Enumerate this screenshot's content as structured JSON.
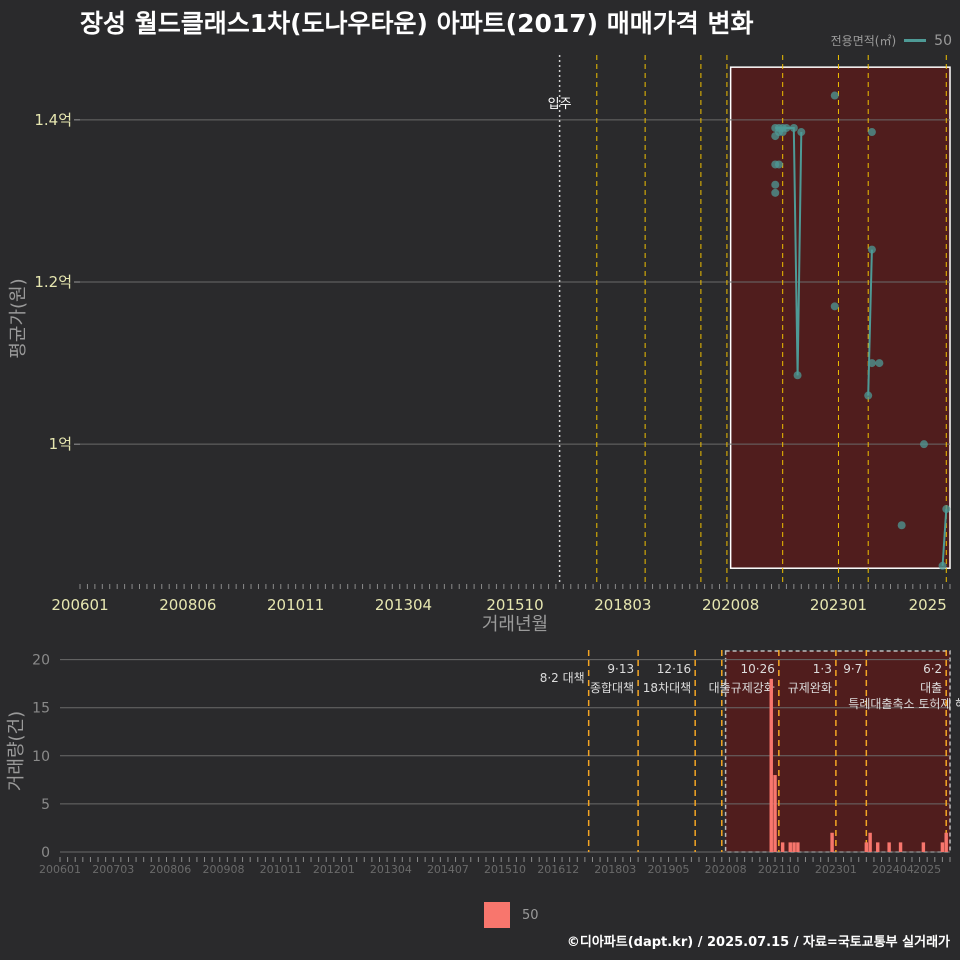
{
  "title": "장성 월드클래스1차(도나우타운) 아파트(2017) 매매가격 변화",
  "caption": "©디아파트(dapt.kr) / 2025.07.15 / 자료=국토교통부 실거래가",
  "legend_top": {
    "title": "전용면적(㎡)",
    "label": "50"
  },
  "legend_bottom": {
    "label": "50"
  },
  "colors": {
    "background": "#2a2a2c",
    "price_line": "#4e9a96",
    "volume_bar": "#f8766d",
    "policy_line": "#f0c000",
    "highlight_fill": "#5a1a1a"
  },
  "chart_data": [
    {
      "type": "line",
      "ylabel": "평균가(원)",
      "xlabel": "거래년월",
      "yticks": [
        {
          "v": 1.0,
          "label": "1억"
        },
        {
          "v": 1.2,
          "label": "1.2억"
        },
        {
          "v": 1.4,
          "label": "1.4억"
        }
      ],
      "ylim": [
        0.83,
        1.48
      ],
      "xticks": [
        "200601",
        "200806",
        "201011",
        "201304",
        "201510",
        "201803",
        "202008",
        "202301",
        "2025"
      ],
      "movein": {
        "x": "2016-10",
        "label": "입주"
      },
      "series": [
        {
          "name": "50",
          "points": [
            {
              "x": "2021-08",
              "y": 1.39
            },
            {
              "x": "2021-08",
              "y": 1.38
            },
            {
              "x": "2021-08",
              "y": 1.345
            },
            {
              "x": "2021-08",
              "y": 1.32
            },
            {
              "x": "2021-08",
              "y": 1.31
            },
            {
              "x": "2021-09",
              "y": 1.39
            },
            {
              "x": "2021-09",
              "y": 1.385
            },
            {
              "x": "2021-09",
              "y": 1.345
            },
            {
              "x": "2021-10",
              "y": 1.39
            },
            {
              "x": "2021-10",
              "y": 1.385
            },
            {
              "x": "2021-11",
              "y": 1.39
            },
            {
              "x": "2022-01",
              "y": 1.39
            },
            {
              "x": "2022-02",
              "y": 1.085
            },
            {
              "x": "2022-03",
              "y": 1.385
            },
            {
              "x": "2022-12",
              "y": 1.43
            },
            {
              "x": "2022-12",
              "y": 1.17
            },
            {
              "x": "2023-09",
              "y": 1.06
            },
            {
              "x": "2023-10",
              "y": 1.385
            },
            {
              "x": "2023-10",
              "y": 1.24
            },
            {
              "x": "2023-10",
              "y": 1.1
            },
            {
              "x": "2023-12",
              "y": 1.1
            },
            {
              "x": "2024-06",
              "y": 0.9
            },
            {
              "x": "2024-12",
              "y": 1.0
            },
            {
              "x": "2025-05",
              "y": 0.85
            },
            {
              "x": "2025-06",
              "y": 0.92
            }
          ],
          "line_path": [
            [
              "2021-08",
              1.39
            ],
            [
              "2021-09",
              1.39
            ],
            [
              "2021-10",
              1.39
            ],
            [
              "2021-11",
              1.39
            ],
            [
              "2022-01",
              1.39
            ],
            [
              "2022-02",
              1.085
            ],
            [
              "2022-03",
              1.385
            ]
          ],
          "line_path2": [
            [
              "2023-09",
              1.06
            ],
            [
              "2023-10",
              1.24
            ]
          ],
          "line_path3": [
            [
              "2025-05",
              0.85
            ],
            [
              "2025-06",
              0.92
            ]
          ]
        }
      ]
    },
    {
      "type": "bar",
      "ylabel": "거래량(건)",
      "yticks": [
        0,
        5,
        10,
        15,
        20
      ],
      "ylim": [
        0,
        21
      ],
      "xticks": [
        "200601",
        "200703",
        "200806",
        "200908",
        "201011",
        "201201",
        "201304",
        "201407",
        "201510",
        "201612",
        "201803",
        "201905",
        "202008",
        "202110",
        "202301",
        "202404",
        "2025"
      ],
      "series": [
        {
          "name": "50",
          "values": [
            {
              "x": "2021-08",
              "y": 18
            },
            {
              "x": "2021-09",
              "y": 8
            },
            {
              "x": "2021-11",
              "y": 1
            },
            {
              "x": "2022-01",
              "y": 1
            },
            {
              "x": "2022-02",
              "y": 1
            },
            {
              "x": "2022-03",
              "y": 1
            },
            {
              "x": "2022-12",
              "y": 2
            },
            {
              "x": "2023-09",
              "y": 1
            },
            {
              "x": "2023-10",
              "y": 2
            },
            {
              "x": "2023-12",
              "y": 1
            },
            {
              "x": "2024-03",
              "y": 1
            },
            {
              "x": "2024-06",
              "y": 1
            },
            {
              "x": "2024-12",
              "y": 1
            },
            {
              "x": "2025-05",
              "y": 1
            },
            {
              "x": "2025-06",
              "y": 2
            }
          ]
        }
      ],
      "policies": [
        {
          "x": "2017-08",
          "label1": "8·2 대책",
          "label2": ""
        },
        {
          "x": "2018-09",
          "label1": "9·13",
          "label2": "종합대책"
        },
        {
          "x": "2019-12",
          "label1": "12·16",
          "label2": "18차대책"
        },
        {
          "x": "2020-07",
          "label1": "",
          "label2": ""
        },
        {
          "x": "2021-10",
          "label1": "10·26",
          "label2": "대출규제강화"
        },
        {
          "x": "2023-01",
          "label1": "1·3",
          "label2": "규제완화"
        },
        {
          "x": "2023-09",
          "label1": "9·7",
          "label2": "특례대출축소 토허제 해"
        },
        {
          "x": "2025-06",
          "label1": "6·2",
          "label2": "대출"
        }
      ],
      "highlight": {
        "from": "2020-08",
        "to": "2025-07"
      }
    }
  ]
}
